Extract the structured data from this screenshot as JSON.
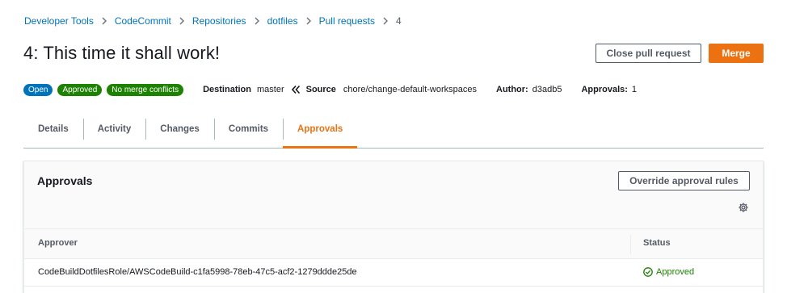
{
  "breadcrumbs": [
    {
      "label": "Developer Tools"
    },
    {
      "label": "CodeCommit"
    },
    {
      "label": "Repositories"
    },
    {
      "label": "dotfiles"
    },
    {
      "label": "Pull requests"
    },
    {
      "label": "4"
    }
  ],
  "title": "4: This time it shall work!",
  "actions": {
    "close_label": "Close pull request",
    "merge_label": "Merge"
  },
  "badges": [
    "Open",
    "Approved",
    "No merge conflicts"
  ],
  "meta": {
    "destination_label": "Destination",
    "destination_value": "master",
    "source_label": "Source",
    "source_value": "chore/change-default-workspaces",
    "author_label": "Author:",
    "author_value": "d3adb5",
    "approvals_label": "Approvals:",
    "approvals_value": "1"
  },
  "tabs": [
    {
      "label": "Details"
    },
    {
      "label": "Activity"
    },
    {
      "label": "Changes"
    },
    {
      "label": "Commits"
    },
    {
      "label": "Approvals",
      "active": true
    }
  ],
  "approvals_panel": {
    "title": "Approvals",
    "override_label": "Override approval rules",
    "columns": [
      "Approver",
      "Status"
    ],
    "rows": [
      {
        "approver": "CodeBuildDotfilesRole/AWSCodeBuild-c1fa5998-78eb-47c5-acf2-1279ddde25de",
        "status": "Approved"
      }
    ]
  },
  "colors": {
    "link": "#0073bb",
    "primary": "#ec7211",
    "success": "#1d8102",
    "open_badge": "#0073bb"
  },
  "icons": [
    "chevron-right-icon",
    "double-chevron-left-icon",
    "gear-icon",
    "check-circle-icon"
  ]
}
